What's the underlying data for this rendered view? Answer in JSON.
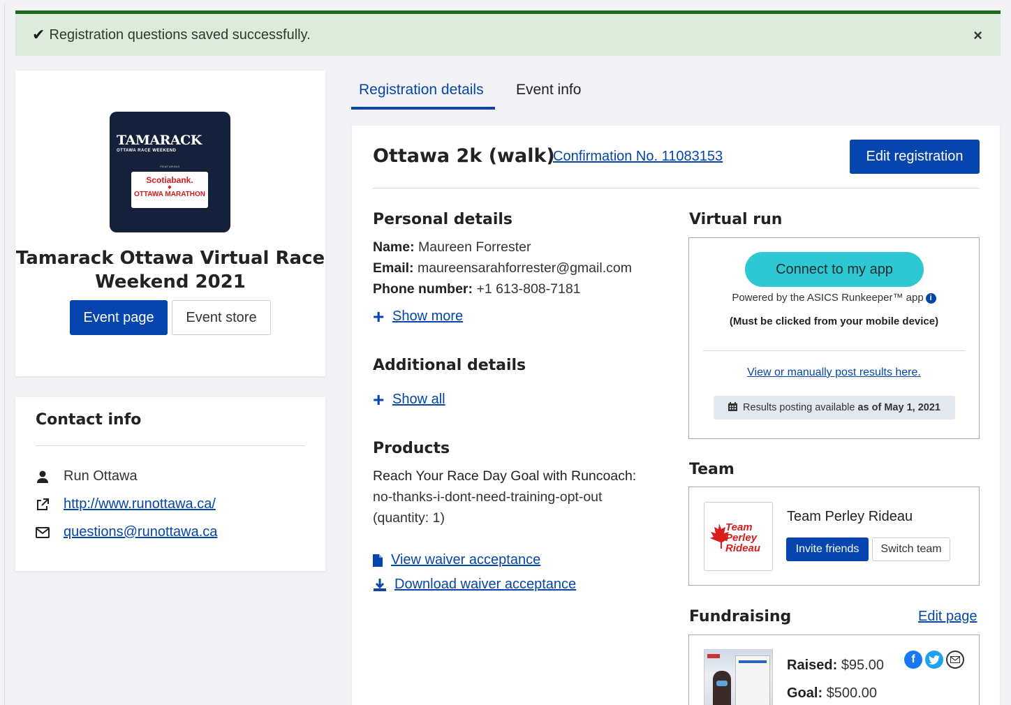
{
  "alert": {
    "message": "Registration questions saved successfully.",
    "close": "×"
  },
  "event": {
    "logo": {
      "brand": "TAMARACK",
      "sub": "OTTAWA RACE WEEKEND",
      "featuring": "FEATURING",
      "sponsor": "Scotiabank.",
      "marathon": "OTTAWA MARATHON"
    },
    "title": "Tamarack Ottawa Virtual Race Weekend 2021",
    "event_page_label": "Event page",
    "event_store_label": "Event store"
  },
  "contact": {
    "heading": "Contact info",
    "name": "Run Ottawa",
    "website": "http://www.runottawa.ca/",
    "email": "questions@runottawa.ca"
  },
  "tabs": [
    {
      "label": "Registration details",
      "active": true
    },
    {
      "label": "Event info",
      "active": false
    }
  ],
  "registration": {
    "title": "Ottawa 2k (walk)",
    "confirmation": "Confirmation No. 11083153",
    "edit_label": "Edit registration",
    "personal": {
      "heading": "Personal details",
      "name_label": "Name:",
      "name": "Maureen Forrester",
      "email_label": "Email:",
      "email": "maureensarahforrester@gmail.com",
      "phone_label": "Phone number:",
      "phone": "+1 613-808-7181",
      "show_more": "Show more"
    },
    "additional": {
      "heading": "Additional details",
      "show_all": "Show all"
    },
    "products": {
      "heading": "Products",
      "item_label": "Reach Your Race Day Goal with Runcoach:",
      "item_value": "no-thanks-i-dont-need-training-opt-out",
      "item_qty": "(quantity: 1)"
    },
    "waiver": {
      "view": "View waiver acceptance",
      "download": "Download waiver acceptance"
    }
  },
  "virtual_run": {
    "heading": "Virtual run",
    "connect_label": "Connect to my app",
    "powered": "Powered by the ASICS Runkeeper™ app",
    "must": "(Must be clicked from your mobile device)",
    "view_link": "View or manually post results here.",
    "results_prefix": "Results posting available",
    "results_date": "as of May 1, 2021"
  },
  "team": {
    "heading": "Team",
    "logo_text": "Team Perley Rideau",
    "name": "Team Perley Rideau",
    "invite_label": "Invite friends",
    "switch_label": "Switch team"
  },
  "fundraising": {
    "heading": "Fundraising",
    "edit_label": "Edit page",
    "raised_label": "Raised:",
    "raised": "$95.00",
    "goal_label": "Goal:",
    "goal": "$500.00"
  },
  "colors": {
    "primary": "#0645ad",
    "success_bar": "#1c6a1c",
    "alert_bg": "#dcebdc",
    "connect": "#2ec8d3"
  }
}
